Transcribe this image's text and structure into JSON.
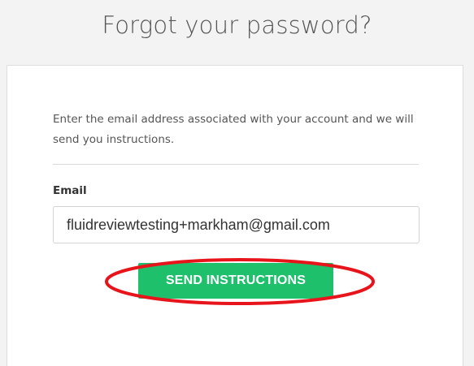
{
  "header": {
    "title": "Forgot your password?"
  },
  "form": {
    "instructions": "Enter the email address associated with your account and we will send you instructions.",
    "email_label": "Email",
    "email_value": "fluidreviewtesting+markham@gmail.com",
    "submit_label": "SEND INSTRUCTIONS"
  },
  "colors": {
    "button": "#1ec06b",
    "annotation": "#e8141b"
  }
}
